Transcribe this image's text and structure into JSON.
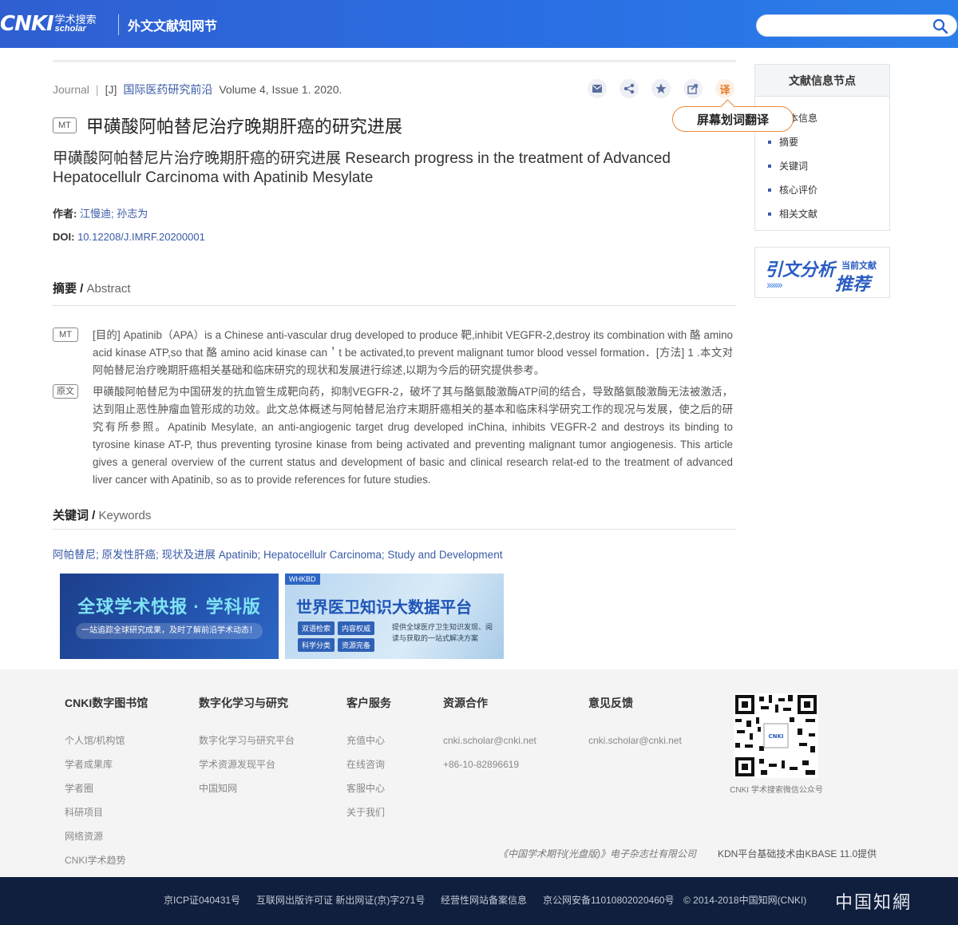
{
  "header": {
    "logo_main": "CNKI",
    "logo_zh": "学术搜索",
    "logo_en": "scholar",
    "site_title": "外文文献知网节",
    "search_placeholder": ""
  },
  "article": {
    "meta": {
      "type": "Journal",
      "sep": "|",
      "code": "[J]",
      "journal": "国际医药研究前沿",
      "volume": "Volume 4, Issue 1. 2020."
    },
    "actions": {
      "translate_label": "译",
      "tooltip": "屏幕划词翻译"
    },
    "badge_mt": "MT",
    "title_zh": "甲磺酸阿帕替尼治疗晚期肝癌的研究进展",
    "title_en": "甲磺酸阿帕替尼片治疗晚期肝癌的研究进展 Research progress in the treatment of Advanced Hepatocellulr Carcinoma with Apatinib Mesylate",
    "authors_label": "作者:",
    "authors": "江慢迪; 孙志为",
    "doi_label": "DOI:",
    "doi": "10.12208/J.IMRF.20200001",
    "abstract_head_zh": "摘要 /",
    "abstract_head_en": "Abstract",
    "abstract_mt_badge": "MT",
    "abstract_mt": "[目的] Apatinib（APA）is a Chinese anti-vascular drug developed to produce 靶,inhibit VEGFR-2,destroy its combination with 酪 amino acid kinase ATP,so that 酪 amino acid kinase can＇t be activated,to prevent malignant tumor blood vessel formation．[方法] 1 .本文对阿帕替尼治疗晚期肝癌相关基础和临床研究的现状和发展进行综述,以期为今后的研究提供参考。",
    "abstract_orig_badge": "原文",
    "abstract_orig": "甲磺酸阿帕替尼为中国研发的抗血管生成靶向药，抑制VEGFR-2，破坏了其与酪氨酸激酶ATP间的结合，导致酪氨酸激酶无法被激活，达到阻止恶性肿瘤血管形成的功效。此文总体概述与阿帕替尼治疗末期肝癌相关的基本和临床科学研究工作的现况与发展，使之后的研究有所参照。Apatinib Mesylate, an anti-angiogenic target drug developed inChina, inhibits VEGFR-2 and destroys its binding to tyrosine kinase AT-P, thus preventing tyrosine kinase from being activated and preventing malignant tumor angiogenesis. This article gives a general overview of the current status and development of basic and clinical research relat-ed to the treatment of advanced liver cancer with Apatinib, so as to provide references for future studies.",
    "keywords_head_zh": "关键词 /",
    "keywords_head_en": "Keywords",
    "keywords": "阿帕替尼; 原发性肝癌; 现状及进展 Apatinib; Hepatocellulr Carcinoma; Study and Development"
  },
  "banners": {
    "b1_title": "全球学术快报 · 学科版",
    "b1_sub": "一站追踪全球研究成果，及时了解前沿学术动态！",
    "b2_tag": "WHKBD",
    "b2_title": "世界医卫知识大数据平台",
    "b2_chips": [
      "双语检索",
      "内容权威",
      "科学分类",
      "资源完备"
    ],
    "b2_desc": "提供全球医疗卫生知识发现、阅读与获取的一站式解决方案"
  },
  "sidebar": {
    "head": "文献信息节点",
    "items": [
      {
        "label": "基本信息"
      },
      {
        "label": "摘要"
      },
      {
        "label": "关键词"
      },
      {
        "label": "核心评价"
      },
      {
        "label": "相关文献"
      }
    ],
    "ad_big": "引文分析",
    "ad_small": "当前文献",
    "ad_push": "推荐",
    "ad_arrows": "›››››››"
  },
  "footer": {
    "cols": [
      {
        "head": "CNKI数字图书馆",
        "links": [
          "个人馆/机构馆",
          "学者成果库",
          "学者圈",
          "科研项目",
          "网络资源",
          "CNKI学术趋势"
        ]
      },
      {
        "head": "数字化学习与研究",
        "links": [
          "数字化学习与研究平台",
          "学术资源发现平台",
          "中国知网"
        ]
      },
      {
        "head": "客户服务",
        "links": [
          "充值中心",
          "在线咨询",
          "客服中心",
          "关于我们"
        ]
      },
      {
        "head": "资源合作",
        "links": [
          "cnki.scholar@cnki.net",
          "+86-10-82896619"
        ]
      },
      {
        "head": "意见反馈",
        "links": [
          "cnki.scholar@cnki.net"
        ]
      }
    ],
    "qr_label": "CNKI 学术搜索微信公众号",
    "publisher": "《中国学术期刊(光盘版)》电子杂志社有限公司",
    "kdn": "KDN平台基础技术由KBASE 11.0提供"
  },
  "bottom": {
    "icp": "京ICP证040431号",
    "license": "互联网出版许可证 新出网证(京)字271号",
    "record": "经营性网站备案信息",
    "police": "京公网安备11010802020460号",
    "copyright": "© 2014-2018中国知网(CNKI)",
    "logo": "中国知網"
  }
}
